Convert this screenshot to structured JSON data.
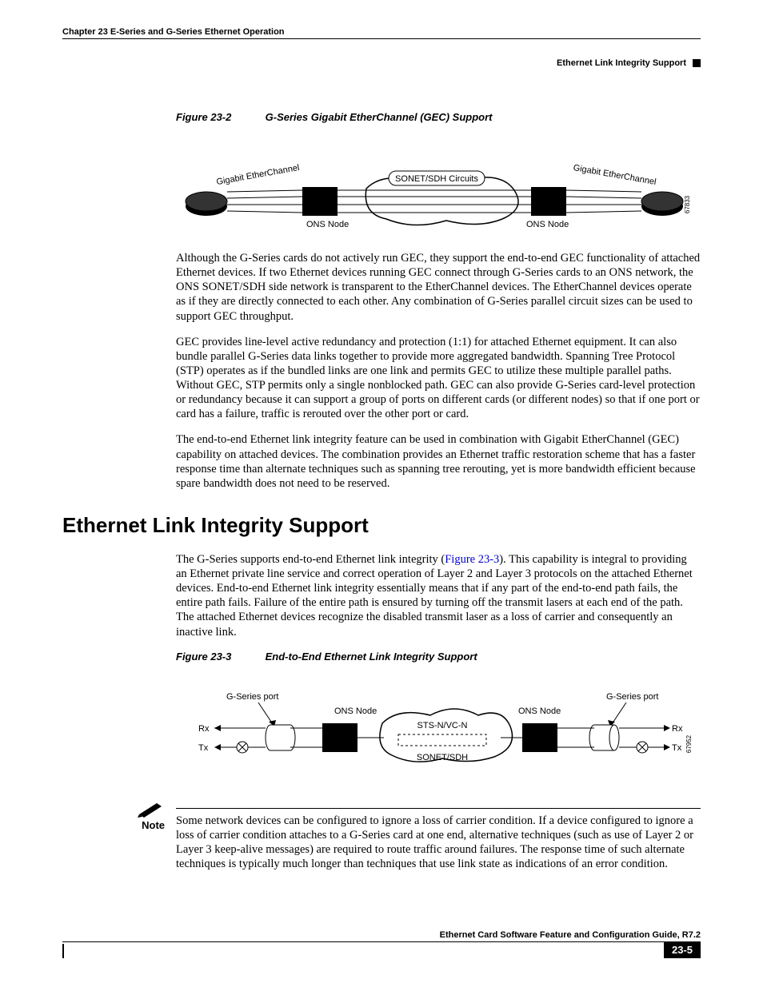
{
  "header": {
    "chapter": "Chapter 23    E-Series and G-Series Ethernet Operation",
    "section": "Ethernet Link Integrity Support"
  },
  "figure1": {
    "label": "Figure 23-2",
    "title": "G-Series Gigabit EtherChannel (GEC) Support",
    "labels": {
      "gec_left": "Gigabit EtherChannel",
      "gec_right": "Gigabit EtherChannel",
      "sonet": "SONET/SDH Circuits",
      "ons_left": "ONS Node",
      "ons_right": "ONS Node",
      "id": "67833"
    }
  },
  "paragraphs": {
    "p1": "Although the G-Series cards do not actively run GEC, they support the end-to-end GEC functionality of attached Ethernet devices. If two Ethernet devices running GEC connect through G-Series cards to an ONS network, the ONS SONET/SDH side network is transparent to the EtherChannel devices. The EtherChannel devices operate as if they are directly connected to each other. Any combination of G-Series parallel circuit sizes can be used to support GEC throughput.",
    "p2": "GEC provides line-level active redundancy and protection (1:1) for attached Ethernet equipment. It can also bundle parallel G-Series data links together to provide more aggregated bandwidth. Spanning Tree Protocol (STP) operates as if the bundled links are one link and permits GEC to utilize these multiple parallel paths. Without GEC, STP permits only a single nonblocked path. GEC can also provide G-Series card-level protection or redundancy because it can support a group of ports on different cards (or different nodes) so that if one port or card has a failure, traffic is rerouted over the other port or card.",
    "p3": "The end-to-end Ethernet link integrity feature can be used in combination with Gigabit EtherChannel (GEC) capability on attached devices. The combination provides an Ethernet traffic restoration scheme that has a faster response time than alternate techniques such as spanning tree rerouting, yet is more bandwidth efficient because spare bandwidth does not need to be reserved."
  },
  "section_heading": "Ethernet Link Integrity Support",
  "link_integrity": {
    "pre": "The G-Series supports end-to-end Ethernet link integrity (",
    "figref": "Figure 23-3",
    "post": "). This capability is integral to providing an Ethernet private line service and correct operation of Layer 2 and Layer 3 protocols on the attached Ethernet devices. End-to-end Ethernet link integrity essentially means that if any part of the end-to-end path fails, the entire path fails. Failure of the entire path is ensured by turning off the transmit lasers at each end of the path. The attached Ethernet devices recognize the disabled transmit laser as a loss of carrier and consequently an inactive link."
  },
  "figure2": {
    "label": "Figure 23-3",
    "title": "End-to-End Ethernet Link Integrity Support",
    "labels": {
      "gport_left": "G-Series port",
      "gport_right": "G-Series port",
      "ons_left": "ONS Node",
      "ons_right": "ONS Node",
      "sts": "STS-N/VC-N",
      "sonet": "SONET/SDH",
      "rx": "Rx",
      "tx": "Tx",
      "id": "67952"
    }
  },
  "note": {
    "label": "Note",
    "text": "Some network devices can be configured to ignore a loss of carrier condition. If a device configured to ignore a loss of carrier condition attaches to a G-Series card at one end, alternative techniques (such as use of Layer 2 or Layer 3 keep-alive messages) are required to route traffic around failures. The response time of such alternate techniques is typically much longer than techniques that use link state as indications of an error condition."
  },
  "footer": {
    "doc_title": "Ethernet Card Software Feature and Configuration Guide, R7.2",
    "page": "23-5"
  }
}
